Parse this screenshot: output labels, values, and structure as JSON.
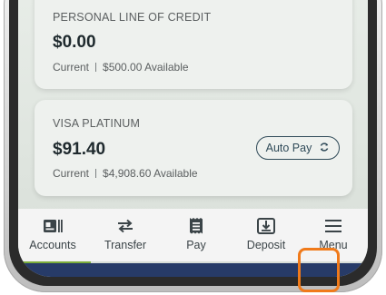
{
  "accounts": [
    {
      "title": "PERSONAL LINE OF CREDIT",
      "amount": "$0.00",
      "current_label": "Current",
      "available": "$500.00 Available"
    },
    {
      "title": "VISA PLATINUM",
      "amount": "$91.40",
      "current_label": "Current",
      "available": "$4,908.60 Available",
      "autopay_label": "Auto Pay"
    }
  ],
  "tabbar": {
    "items": [
      {
        "label": "Accounts",
        "icon": "accounts-icon"
      },
      {
        "label": "Transfer",
        "icon": "transfer-icon"
      },
      {
        "label": "Pay",
        "icon": "pay-icon"
      },
      {
        "label": "Deposit",
        "icon": "deposit-icon"
      },
      {
        "label": "Menu",
        "icon": "menu-icon"
      }
    ],
    "highlight_color": "#f07a1a"
  },
  "colors": {
    "card_bg": "#eef1ee",
    "text_dark": "#1f2a2e",
    "accent_green": "#7cae3a",
    "bottom_navy": "#273b68"
  }
}
